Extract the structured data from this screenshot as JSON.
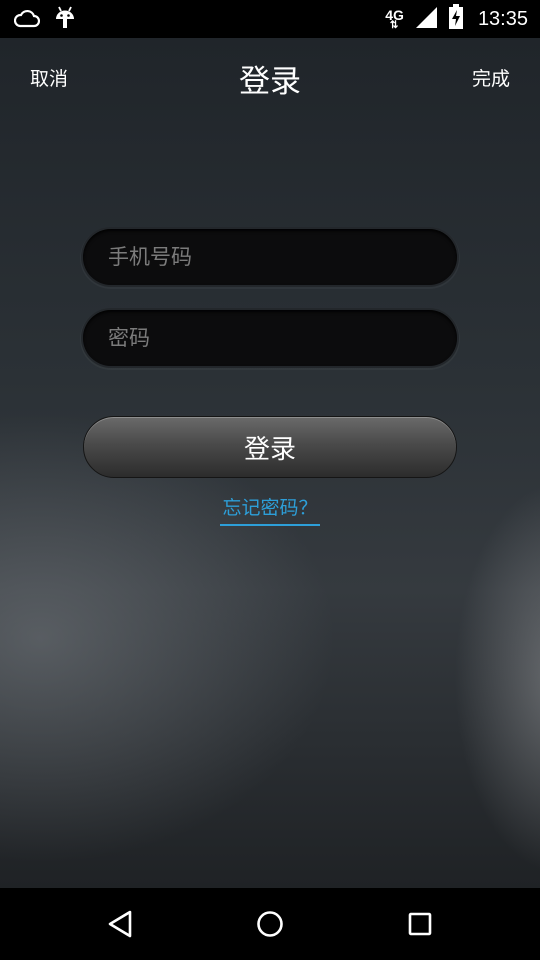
{
  "status_bar": {
    "network_label": "4G",
    "time": "13:35",
    "icons": [
      "cloud-icon",
      "android-icon",
      "network-4g-icon",
      "signal-icon",
      "battery-charging-icon"
    ]
  },
  "header": {
    "cancel_label": "取消",
    "title": "登录",
    "done_label": "完成"
  },
  "form": {
    "phone_placeholder": "手机号码",
    "phone_value": "",
    "password_placeholder": "密码",
    "password_value": "",
    "login_label": "登录",
    "forgot_label": "忘记密码？"
  },
  "nav_bar": {
    "icons": [
      "back-icon",
      "home-icon",
      "recents-icon"
    ]
  },
  "colors": {
    "link": "#2d9fd9",
    "status_bar": "#000000"
  }
}
